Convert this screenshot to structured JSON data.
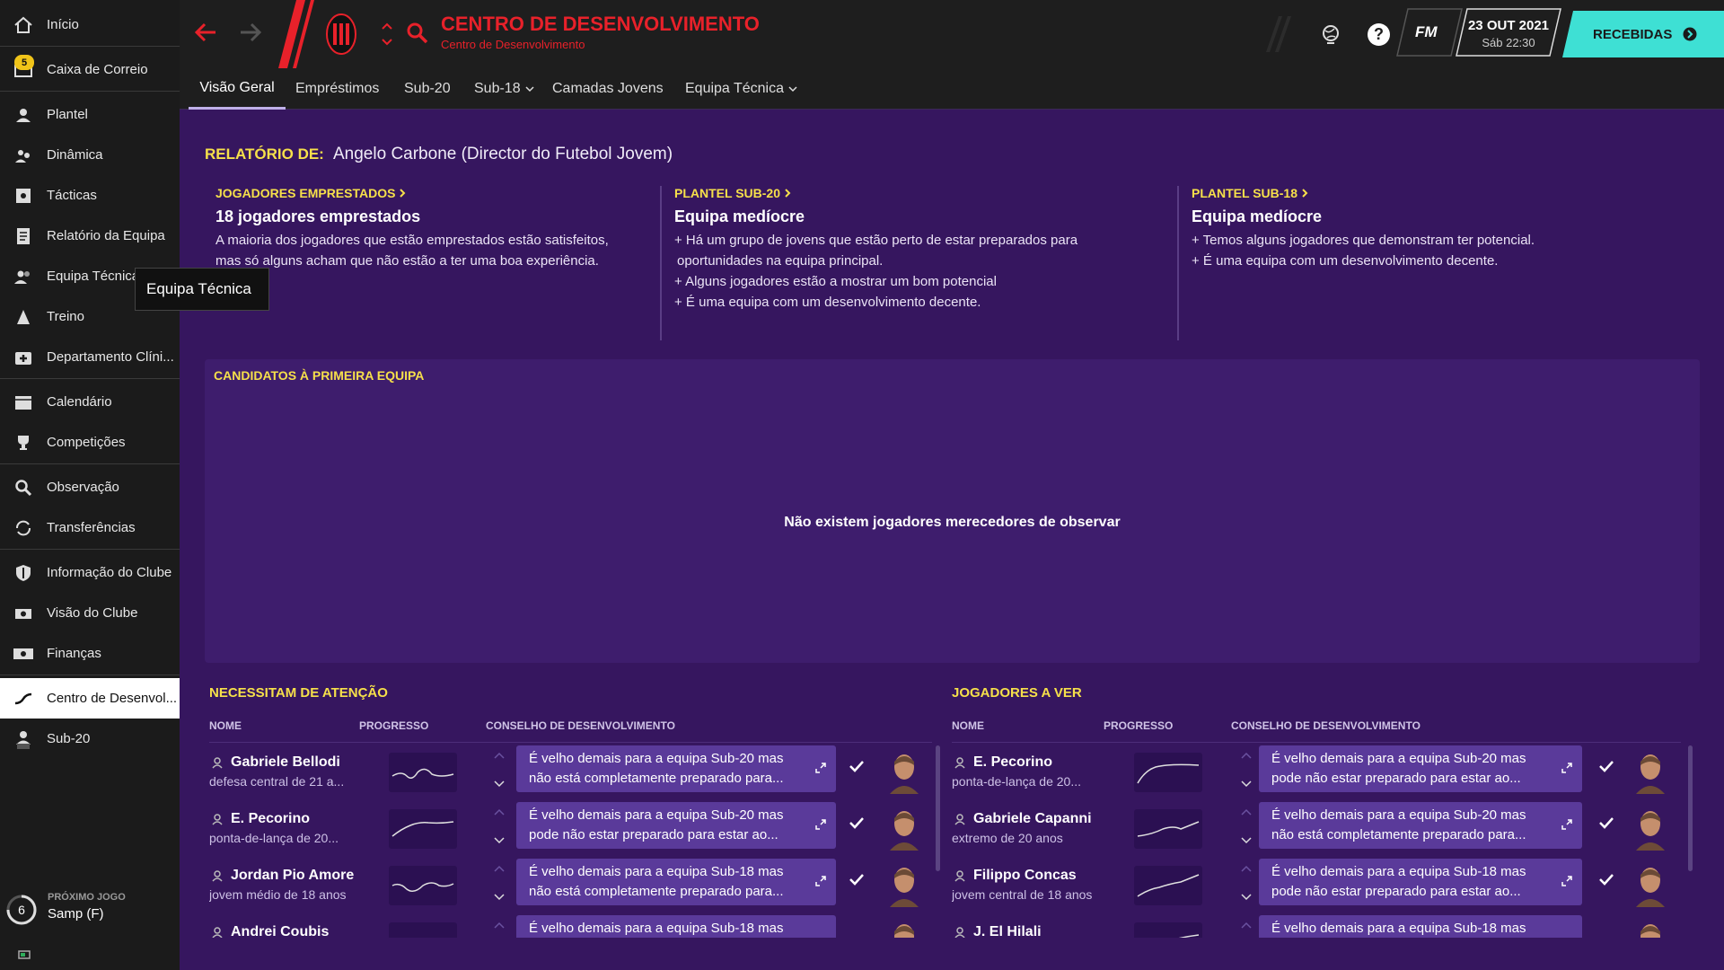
{
  "sidebar": {
    "items": [
      {
        "label": "Início",
        "icon": "home-icon"
      },
      {
        "label": "Caixa de Correio",
        "icon": "mail-icon",
        "badge": "5"
      },
      {
        "label": "Plantel",
        "icon": "players-icon"
      },
      {
        "label": "Dinâmica",
        "icon": "dynamics-icon"
      },
      {
        "label": "Tácticas",
        "icon": "tactics-icon"
      },
      {
        "label": "Relatório da Equipa",
        "icon": "report-icon"
      },
      {
        "label": "Equipa Técnica",
        "icon": "staff-icon"
      },
      {
        "label": "Treino",
        "icon": "training-icon"
      },
      {
        "label": "Departamento Clíni...",
        "icon": "medical-icon"
      },
      {
        "label": "Calendário",
        "icon": "calendar-icon"
      },
      {
        "label": "Competições",
        "icon": "trophy-icon"
      },
      {
        "label": "Observação",
        "icon": "scouting-icon"
      },
      {
        "label": "Transferências",
        "icon": "transfers-icon"
      },
      {
        "label": "Informação do Clube",
        "icon": "shield-icon"
      },
      {
        "label": "Visão do Clube",
        "icon": "vision-icon"
      },
      {
        "label": "Finanças",
        "icon": "finances-icon"
      },
      {
        "label": "Centro de Desenvol...",
        "icon": "development-icon",
        "active": true
      },
      {
        "label": "Sub-20",
        "icon": "u20-icon"
      }
    ],
    "tooltip": "Equipa Técnica",
    "next_match": {
      "label": "PRÓXIMO JOGO",
      "opponent": "Samp (F)",
      "days": "6"
    }
  },
  "header": {
    "title": "CENTRO DE DESENVOLVIMENTO",
    "subtitle": "Centro de Desenvolvimento",
    "date": "23 OUT 2021",
    "day_time": "Sáb 22:30",
    "fm_label": "FM",
    "continue_label": "RECEBIDAS",
    "help_label": "?"
  },
  "tabs": [
    "Visão Geral",
    "Empréstimos",
    "Sub-20",
    "Sub-18",
    "Camadas Jovens",
    "Equipa Técnica"
  ],
  "report": {
    "label": "RELATÓRIO DE:",
    "author": "Angelo Carbone (Director do Futebol Jovem)",
    "columns": [
      {
        "heading": "JOGADORES EMPRESTADOS",
        "title": "18 jogadores emprestados",
        "lines": [
          "A maioria dos jogadores que estão emprestados estão satisfeitos,",
          "mas só alguns acham que não estão a ter uma boa experiência."
        ]
      },
      {
        "heading": "PLANTEL SUB-20",
        "title": "Equipa medíocre",
        "lines": [
          "+ Há um grupo de jovens que estão perto de estar preparados para",
          "oportunidades na equipa principal.",
          "+ Alguns jogadores estão a mostrar um bom potencial",
          "+ É uma equipa com um desenvolvimento decente."
        ]
      },
      {
        "heading": "PLANTEL SUB-18",
        "title": "Equipa medíocre",
        "lines": [
          "+ Temos alguns jogadores que demonstram ter potencial.",
          "+ É uma equipa com um desenvolvimento decente."
        ]
      }
    ]
  },
  "candidates": {
    "heading": "CANDIDATOS À PRIMEIRA EQUIPA",
    "empty_message": "Não existem jogadores merecedores de observar"
  },
  "attention": {
    "heading": "NECESSITAM DE ATENÇÃO",
    "col_name": "NOME",
    "col_progress": "PROGRESSO",
    "col_advice": "CONSELHO DE DESENVOLVIMENTO",
    "rows": [
      {
        "name": "Gabriele Bellodi",
        "desc": "defesa central de 21 a...",
        "advice1": "É velho demais para a equipa Sub-20 mas",
        "advice2": "não está completamente preparado para..."
      },
      {
        "name": "E. Pecorino",
        "desc": "ponta-de-lança de 20...",
        "advice1": "É velho demais para a equipa Sub-20 mas",
        "advice2": "pode não estar preparado para estar ao..."
      },
      {
        "name": "Jordan Pio Amore",
        "desc": "jovem médio de 18 anos",
        "advice1": "É velho demais para a equipa Sub-18 mas",
        "advice2": "não está completamente preparado para..."
      },
      {
        "name": "Andrei Coubis",
        "desc": "",
        "advice1": "É velho demais para a equipa Sub-18 mas",
        "advice2": ""
      }
    ]
  },
  "watch": {
    "heading": "JOGADORES A VER",
    "col_name": "NOME",
    "col_progress": "PROGRESSO",
    "col_advice": "CONSELHO DE DESENVOLVIMENTO",
    "rows": [
      {
        "name": "E. Pecorino",
        "desc": "ponta-de-lança de 20...",
        "advice1": "É velho demais para a equipa Sub-20 mas",
        "advice2": "pode não estar preparado para estar ao..."
      },
      {
        "name": "Gabriele Capanni",
        "desc": "extremo de 20 anos",
        "advice1": "É velho demais para a equipa Sub-20 mas",
        "advice2": "não está completamente preparado para..."
      },
      {
        "name": "Filippo Concas",
        "desc": "jovem central de 18 anos",
        "advice1": "É velho demais para a equipa Sub-18 mas",
        "advice2": "pode não estar preparado para estar ao..."
      },
      {
        "name": "J. El Hilali",
        "desc": "",
        "advice1": "É velho demais para a equipa Sub-18 mas",
        "advice2": ""
      }
    ]
  },
  "colors": {
    "accent": "#f6e04a",
    "title_red": "#e8212a",
    "teal": "#3ee0d4",
    "bg": "#36165f"
  }
}
